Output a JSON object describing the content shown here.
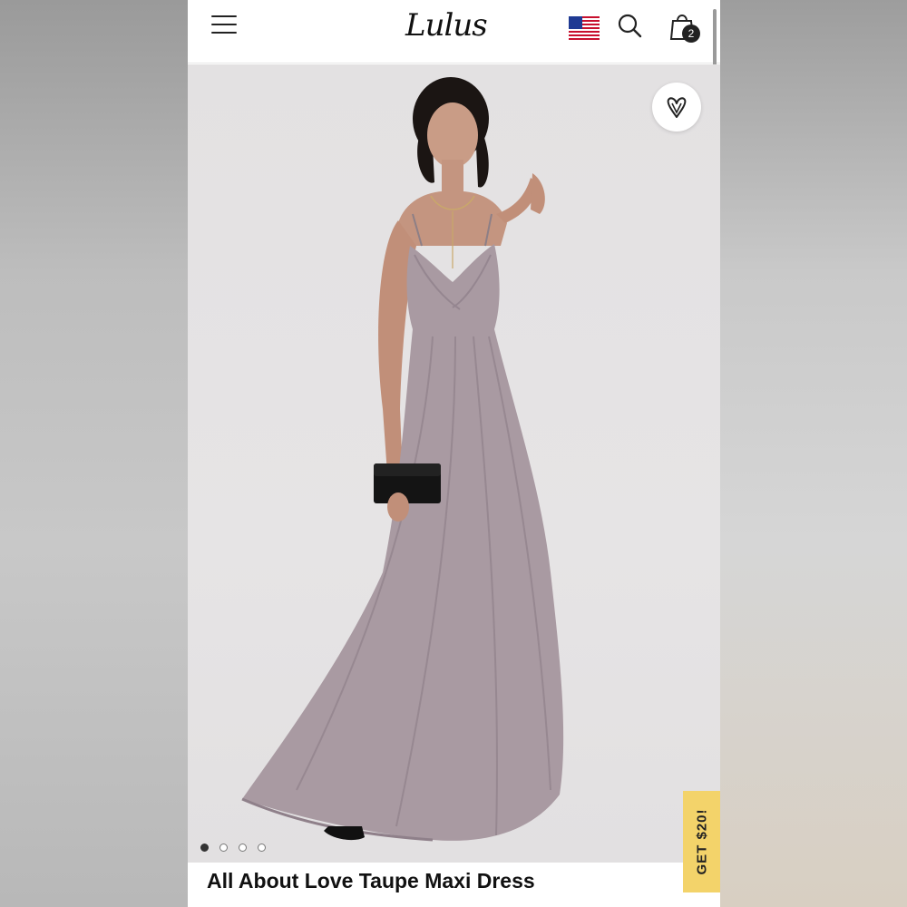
{
  "header": {
    "logo_text": "Lulus",
    "cart_count": "2",
    "icons": [
      "hamburger-menu-icon",
      "us-flag-icon",
      "search-icon",
      "shopping-bag-icon"
    ]
  },
  "product": {
    "title": "All About Love Taupe Maxi Dress",
    "gallery": {
      "image_count": 4,
      "current_index": 1
    },
    "wishlist_icon": "heart-icon"
  },
  "promo": {
    "label": "GET $20!",
    "color": "#f3d36a"
  },
  "colors": {
    "dress": "#a99aa2",
    "background": "#e4e2e3"
  }
}
